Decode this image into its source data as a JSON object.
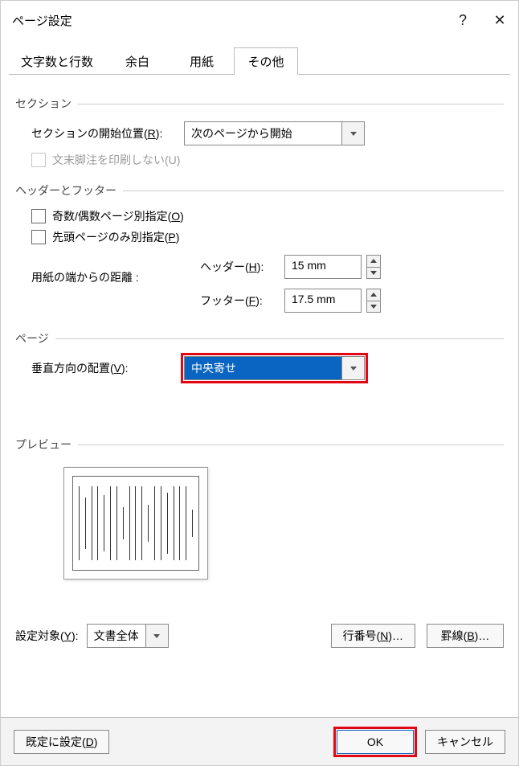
{
  "titlebar": {
    "title": "ページ設定",
    "help_label": "?",
    "close_label": "✕"
  },
  "tabs": {
    "chars_lines": "文字数と行数",
    "margins": "余白",
    "paper": "用紙",
    "other": "その他"
  },
  "section": {
    "heading": "セクション",
    "start_label_pre": "セクションの開始位置(",
    "start_label_key": "R",
    "start_label_post": "):",
    "start_value": "次のページから開始",
    "suppress_endnotes_label": "文末脚注を印刷しない(U)"
  },
  "headerfooter": {
    "heading": "ヘッダーとフッター",
    "odd_even_label_pre": "奇数/偶数ページ別指定(",
    "odd_even_key": "O",
    "odd_even_label_post": ")",
    "first_page_label_pre": "先頭ページのみ別指定(",
    "first_page_key": "P",
    "first_page_label_post": ")",
    "distance_label": "用紙の端からの距離 :",
    "header_label_pre": "ヘッダー(",
    "header_key": "H",
    "header_label_post": "):",
    "header_value": "15 mm",
    "footer_label_pre": "フッター(",
    "footer_key": "F",
    "footer_label_post": "):",
    "footer_value": "17.5 mm"
  },
  "page": {
    "heading": "ページ",
    "valign_label_pre": "垂直方向の配置(",
    "valign_key": "V",
    "valign_label_post": "):",
    "valign_value": "中央寄せ"
  },
  "preview": {
    "heading": "プレビュー"
  },
  "apply": {
    "label_pre": "設定対象(",
    "label_key": "Y",
    "label_post": "):",
    "value": "文書全体",
    "line_numbers_pre": "行番号(",
    "line_numbers_key": "N",
    "line_numbers_post": ")…",
    "borders_pre": "罫線(",
    "borders_key": "B",
    "borders_post": ")…"
  },
  "footer": {
    "set_default_pre": "既定に設定(",
    "set_default_key": "D",
    "set_default_post": ")",
    "ok": "OK",
    "cancel": "キャンセル"
  }
}
